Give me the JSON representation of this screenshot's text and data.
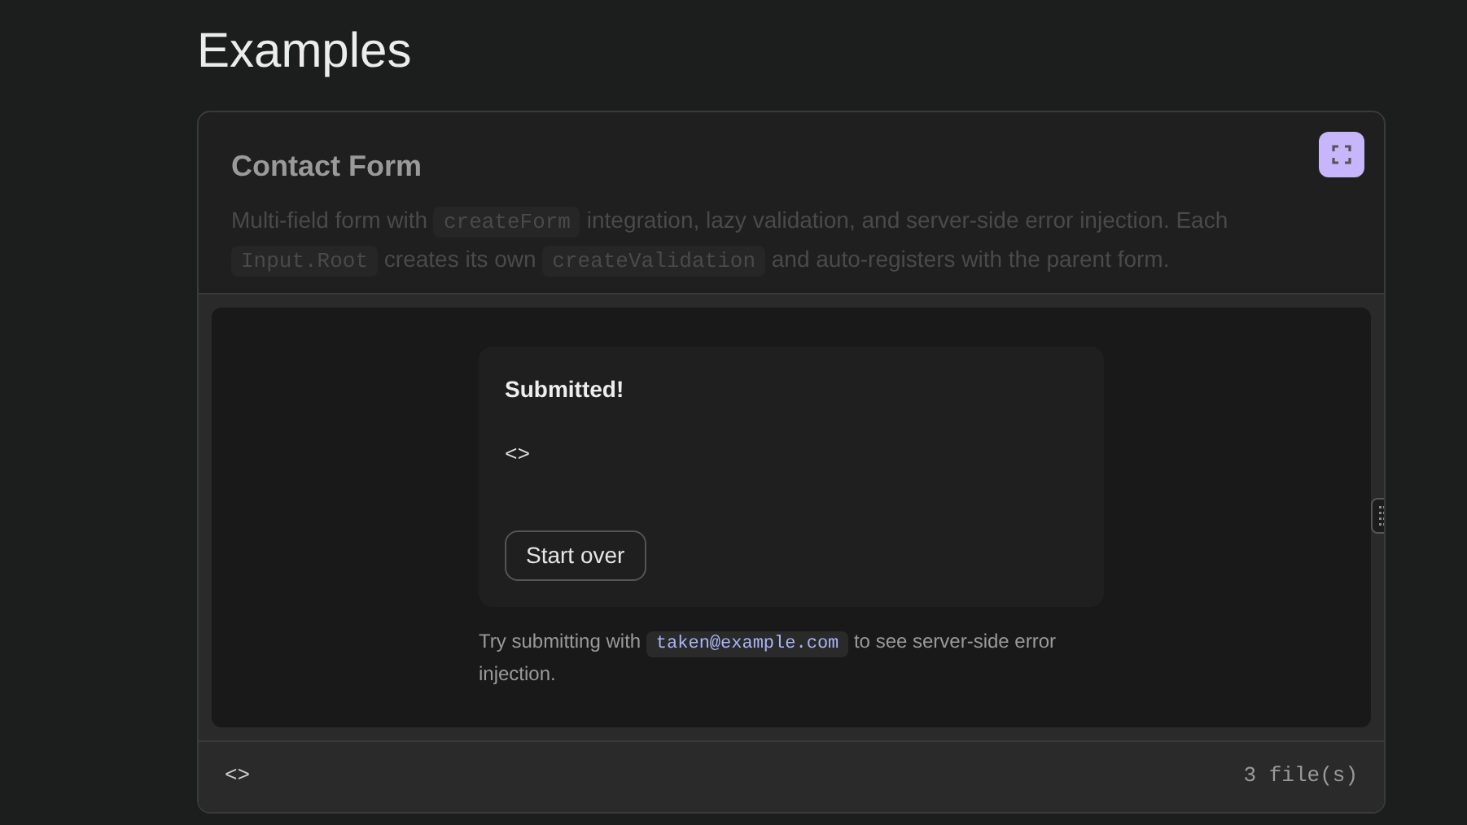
{
  "page_title": "Examples",
  "example": {
    "title": "Contact Form",
    "description": [
      {
        "kind": "text",
        "text": "Multi-field form with "
      },
      {
        "kind": "code",
        "text": "createForm"
      },
      {
        "kind": "text",
        "text": " integration, lazy validation, and server-side error injection. Each "
      },
      {
        "kind": "code",
        "text": "Input.Root"
      },
      {
        "kind": "text",
        "text": " creates its own "
      },
      {
        "kind": "code",
        "text": "createValidation"
      },
      {
        "kind": "text",
        "text": " and auto-registers with the parent form."
      }
    ],
    "result": {
      "heading": "Submitted!",
      "value": "<>",
      "button": "Start over"
    },
    "hint": [
      {
        "kind": "text",
        "text": "Try submitting with "
      },
      {
        "kind": "code",
        "text": "taken@example.com"
      },
      {
        "kind": "text",
        "text": " to see server-side error injection."
      }
    ],
    "footer": {
      "code_toggle": "<>",
      "file_count": "3 file(s)"
    }
  }
}
